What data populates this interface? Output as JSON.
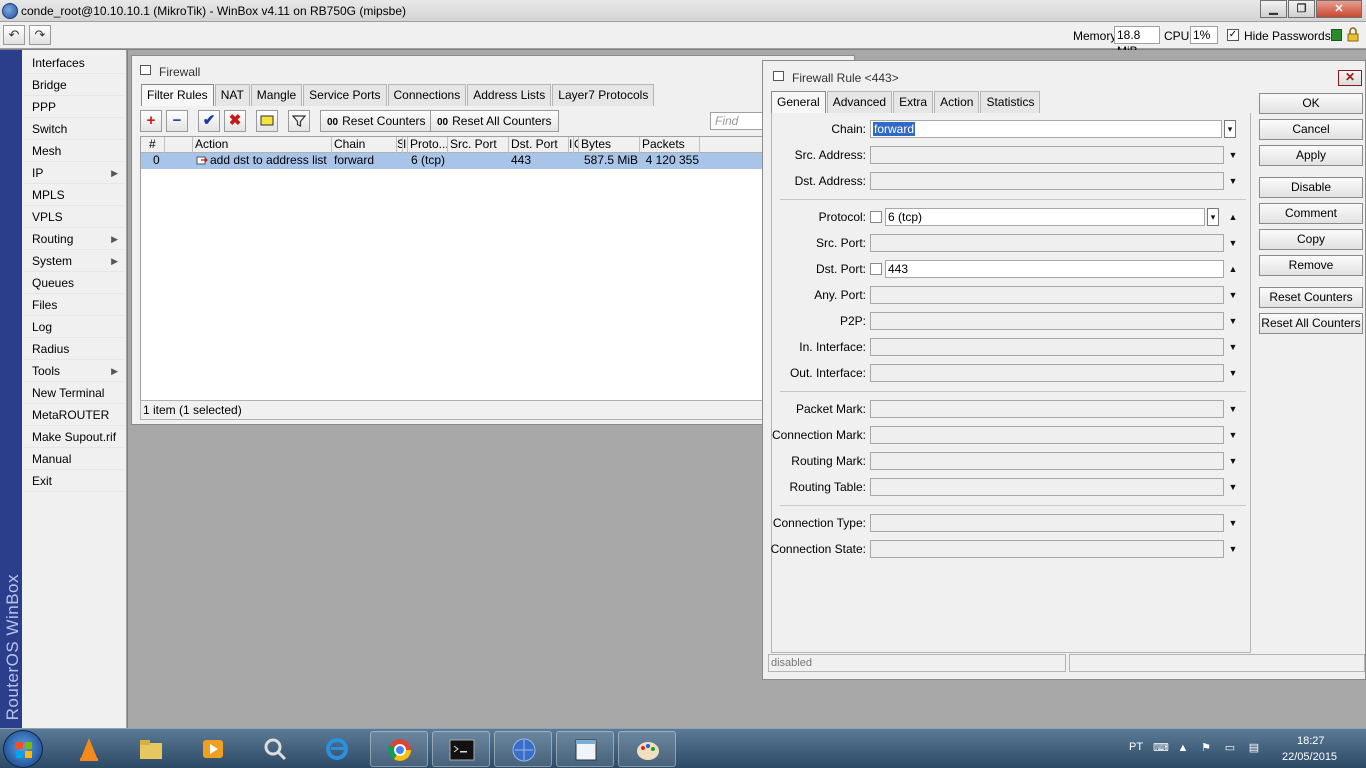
{
  "window": {
    "title": "conde_root@10.10.10.1 (MikroTik) - WinBox v4.11 on RB750G (mipsbe)",
    "minimize": "▁",
    "maximize": "❐",
    "close": "✕"
  },
  "toolbar": {
    "undo_icon": "↶",
    "redo_icon": "↷",
    "memory_label": "Memory:",
    "memory_value": "18.8 MiB",
    "cpu_label": "CPU:",
    "cpu_value": "1%",
    "hide_passwords_label": "Hide Passwords",
    "hide_passwords_checked": "✓"
  },
  "brand": "RouterOS WinBox",
  "menu": [
    {
      "label": "Interfaces",
      "submenu": ""
    },
    {
      "label": "Bridge",
      "submenu": ""
    },
    {
      "label": "PPP",
      "submenu": ""
    },
    {
      "label": "Switch",
      "submenu": ""
    },
    {
      "label": "Mesh",
      "submenu": ""
    },
    {
      "label": "IP",
      "submenu": "▶"
    },
    {
      "label": "MPLS",
      "submenu": ""
    },
    {
      "label": "VPLS",
      "submenu": ""
    },
    {
      "label": "Routing",
      "submenu": "▶"
    },
    {
      "label": "System",
      "submenu": "▶"
    },
    {
      "label": "Queues",
      "submenu": ""
    },
    {
      "label": "Files",
      "submenu": ""
    },
    {
      "label": "Log",
      "submenu": ""
    },
    {
      "label": "Radius",
      "submenu": ""
    },
    {
      "label": "Tools",
      "submenu": "▶"
    },
    {
      "label": "New Terminal",
      "submenu": ""
    },
    {
      "label": "MetaROUTER",
      "submenu": ""
    },
    {
      "label": "Make Supout.rif",
      "submenu": ""
    },
    {
      "label": "Manual",
      "submenu": ""
    },
    {
      "label": "Exit",
      "submenu": ""
    }
  ],
  "firewall": {
    "title": "Firewall",
    "tabs": [
      "Filter Rules",
      "NAT",
      "Mangle",
      "Service Ports",
      "Connections",
      "Address Lists",
      "Layer7 Protocols"
    ],
    "actions": {
      "add": "+",
      "remove": "−",
      "enable": "✔",
      "disable": "✖",
      "comment": "",
      "filter": "▼",
      "counter_glyph": "00",
      "reset_counters": "Reset Counters",
      "reset_all_counters": "Reset All Counters"
    },
    "find_placeholder": "Find",
    "columns": [
      "#",
      "",
      "Action",
      "Chain",
      "S",
      "I",
      "Proto...",
      "Src. Port",
      "Dst. Port",
      "I",
      "O",
      "Bytes",
      "Packets"
    ],
    "rows": [
      {
        "num": "0",
        "action": "add dst to address list",
        "chain": "forward",
        "protocol": "6 (tcp)",
        "src_port": "",
        "dst_port": "443",
        "bytes": "587.5 MiB",
        "packets": "4 120 355"
      }
    ],
    "status": "1 item (1 selected)"
  },
  "rule": {
    "title": "Firewall Rule <443>",
    "close": "✕",
    "tabs": [
      "General",
      "Advanced",
      "Extra",
      "Action",
      "Statistics"
    ],
    "fields": {
      "chain": {
        "label": "Chain:",
        "value": "forward"
      },
      "src_address": {
        "label": "Src. Address:",
        "value": ""
      },
      "dst_address": {
        "label": "Dst. Address:",
        "value": ""
      },
      "protocol": {
        "label": "Protocol:",
        "value": "6 (tcp)"
      },
      "src_port": {
        "label": "Src. Port:",
        "value": ""
      },
      "dst_port": {
        "label": "Dst. Port:",
        "value": "443"
      },
      "any_port": {
        "label": "Any. Port:",
        "value": ""
      },
      "p2p": {
        "label": "P2P:",
        "value": ""
      },
      "in_interface": {
        "label": "In. Interface:",
        "value": ""
      },
      "out_interface": {
        "label": "Out. Interface:",
        "value": ""
      },
      "packet_mark": {
        "label": "Packet Mark:",
        "value": ""
      },
      "connection_mark": {
        "label": "Connection Mark:",
        "value": ""
      },
      "routing_mark": {
        "label": "Routing Mark:",
        "value": ""
      },
      "routing_table": {
        "label": "Routing Table:",
        "value": ""
      },
      "connection_type": {
        "label": "Connection Type:",
        "value": ""
      },
      "connection_state": {
        "label": "Connection State:",
        "value": ""
      }
    },
    "dropdown_glyph": "▼",
    "combo_glyph": "▾",
    "collapse_glyph": "▲",
    "buttons": {
      "ok": "OK",
      "cancel": "Cancel",
      "apply": "Apply",
      "disable": "Disable",
      "comment": "Comment",
      "copy": "Copy",
      "remove": "Remove",
      "reset_counters": "Reset Counters",
      "reset_all_counters": "Reset All Counters"
    },
    "status": "disabled"
  },
  "taskbar": {
    "language": "PT",
    "time": "18:27",
    "date": "22/05/2015",
    "apps": [
      "vlc-icon",
      "file-explorer-icon",
      "media-player-icon",
      "search-tool-icon",
      "internet-explorer-icon",
      "chrome-icon",
      "command-prompt-icon",
      "winbox-icon",
      "notepad-icon",
      "paint-icon"
    ]
  }
}
